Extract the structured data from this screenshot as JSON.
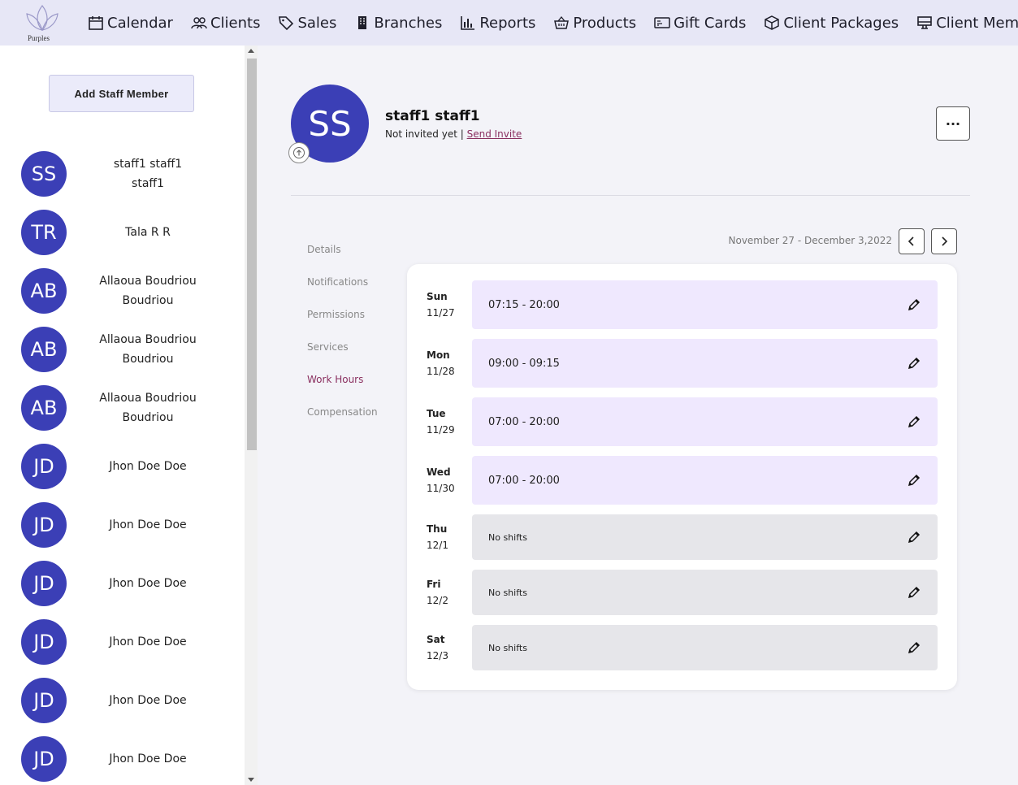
{
  "brand": {
    "name": "Purples"
  },
  "nav": [
    {
      "label": "Calendar",
      "icon": "calendar-icon"
    },
    {
      "label": "Clients",
      "icon": "users-icon"
    },
    {
      "label": "Sales",
      "icon": "tag-icon"
    },
    {
      "label": "Branches",
      "icon": "building-icon"
    },
    {
      "label": "Reports",
      "icon": "bar-chart-icon"
    },
    {
      "label": "Products",
      "icon": "basket-icon"
    },
    {
      "label": "Gift Cards",
      "icon": "card-icon"
    },
    {
      "label": "Client Packages",
      "icon": "box-icon"
    },
    {
      "label": "Client Memb",
      "icon": "monitor-icon"
    }
  ],
  "sidebar": {
    "add_button": "Add Staff Member",
    "staff": [
      {
        "initials": "SS",
        "name": "staff1 staff1 staff1"
      },
      {
        "initials": "TR",
        "name": "Tala R R"
      },
      {
        "initials": "AB",
        "name": "Allaoua Boudriou Boudriou"
      },
      {
        "initials": "AB",
        "name": "Allaoua Boudriou Boudriou"
      },
      {
        "initials": "AB",
        "name": "Allaoua Boudriou Boudriou"
      },
      {
        "initials": "JD",
        "name": "Jhon Doe Doe"
      },
      {
        "initials": "JD",
        "name": "Jhon Doe Doe"
      },
      {
        "initials": "JD",
        "name": "Jhon Doe Doe"
      },
      {
        "initials": "JD",
        "name": "Jhon Doe Doe"
      },
      {
        "initials": "JD",
        "name": "Jhon Doe Doe"
      },
      {
        "initials": "JD",
        "name": "Jhon Doe Doe"
      }
    ]
  },
  "profile": {
    "initials": "SS",
    "name": "staff1 staff1",
    "status": "Not invited yet |",
    "invite_link": "Send Invite",
    "more_label": "···"
  },
  "tabs": [
    {
      "label": "Details",
      "active": false
    },
    {
      "label": "Notifications",
      "active": false
    },
    {
      "label": "Permissions",
      "active": false
    },
    {
      "label": "Services",
      "active": false
    },
    {
      "label": "Work Hours",
      "active": true
    },
    {
      "label": "Compensation",
      "active": false
    }
  ],
  "week": {
    "range": "November 27 - December 3,2022"
  },
  "days": [
    {
      "day": "Sun",
      "date": "11/27",
      "shift": "07:15 - 20:00",
      "has_shift": true
    },
    {
      "day": "Mon",
      "date": "11/28",
      "shift": "09:00 - 09:15",
      "has_shift": true
    },
    {
      "day": "Tue",
      "date": "11/29",
      "shift": "07:00 - 20:00",
      "has_shift": true
    },
    {
      "day": "Wed",
      "date": "11/30",
      "shift": "07:00 - 20:00",
      "has_shift": true
    },
    {
      "day": "Thu",
      "date": "12/1",
      "shift": "No shifts",
      "has_shift": false
    },
    {
      "day": "Fri",
      "date": "12/2",
      "shift": "No shifts",
      "has_shift": false
    },
    {
      "day": "Sat",
      "date": "12/3",
      "shift": "No shifts",
      "has_shift": false
    }
  ],
  "colors": {
    "accent": "#3b3fb6",
    "active_tab": "#8a2f5f",
    "shift_bg": "#efe8fe",
    "no_shift_bg": "#e6e6ea",
    "nav_bg": "#e7e7f6"
  }
}
